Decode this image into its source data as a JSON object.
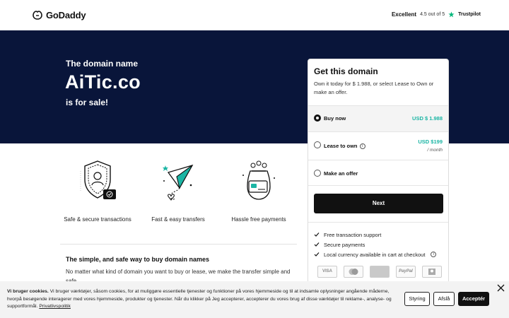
{
  "header": {
    "logo_text": "GoDaddy",
    "rating_label": "Excellent",
    "rating_score": "4.5 out of 5",
    "trustpilot": "Trustpilot"
  },
  "hero": {
    "eyebrow": "The domain name",
    "domain": "AiTic.co",
    "suffix": "is for sale!"
  },
  "features": [
    {
      "label": "Safe & secure transactions",
      "icon": "shield-user-icon"
    },
    {
      "label": "Fast & easy transfers",
      "icon": "paper-plane-icon"
    },
    {
      "label": "Hassle free payments",
      "icon": "money-card-icon"
    }
  ],
  "info": {
    "title": "The simple, and safe way to buy domain names",
    "text": "No matter what kind of domain you want to buy or lease, we make the transfer simple and safe."
  },
  "card": {
    "title": "Get this domain",
    "subtitle": "Own it today for $ 1.988, or select Lease to Own or make an offer.",
    "options": [
      {
        "label": "Buy now",
        "price": "USD $ 1.988",
        "selected": true
      },
      {
        "label": "Lease to own",
        "price": "USD $199",
        "per": "/ month",
        "selected": false
      },
      {
        "label": "Make an offer",
        "selected": false
      }
    ],
    "next_label": "Next",
    "benefits": [
      "Free transaction support",
      "Secure payments",
      "Local currency available in cart at checkout"
    ],
    "payments": [
      "VISA",
      "mastercard",
      "amex",
      "PayPal",
      "bank"
    ]
  },
  "cookie": {
    "title": "Vi bruger cookies.",
    "text": "Vi bruger værktøjer, såsom cookies, for at muliggøre essentielle tjenester og funktioner på vores hjemmeside og til at indsamle oplysninger angående måderne, hvorpå besøgende interagerer med vores hjemmeside, produkter og tjenester. Når du klikker på Jeg accepterer, accepterer du vores brug af disse værktøjer til reklame-, analyse- og supportformål.",
    "link": "Privatlivspolitik",
    "manage": "Styring",
    "decline": "Afslå",
    "accept": "Acceptér"
  },
  "colors": {
    "hero_bg": "#09153a",
    "accent_price": "#1bb5a4",
    "button": "#111111"
  }
}
